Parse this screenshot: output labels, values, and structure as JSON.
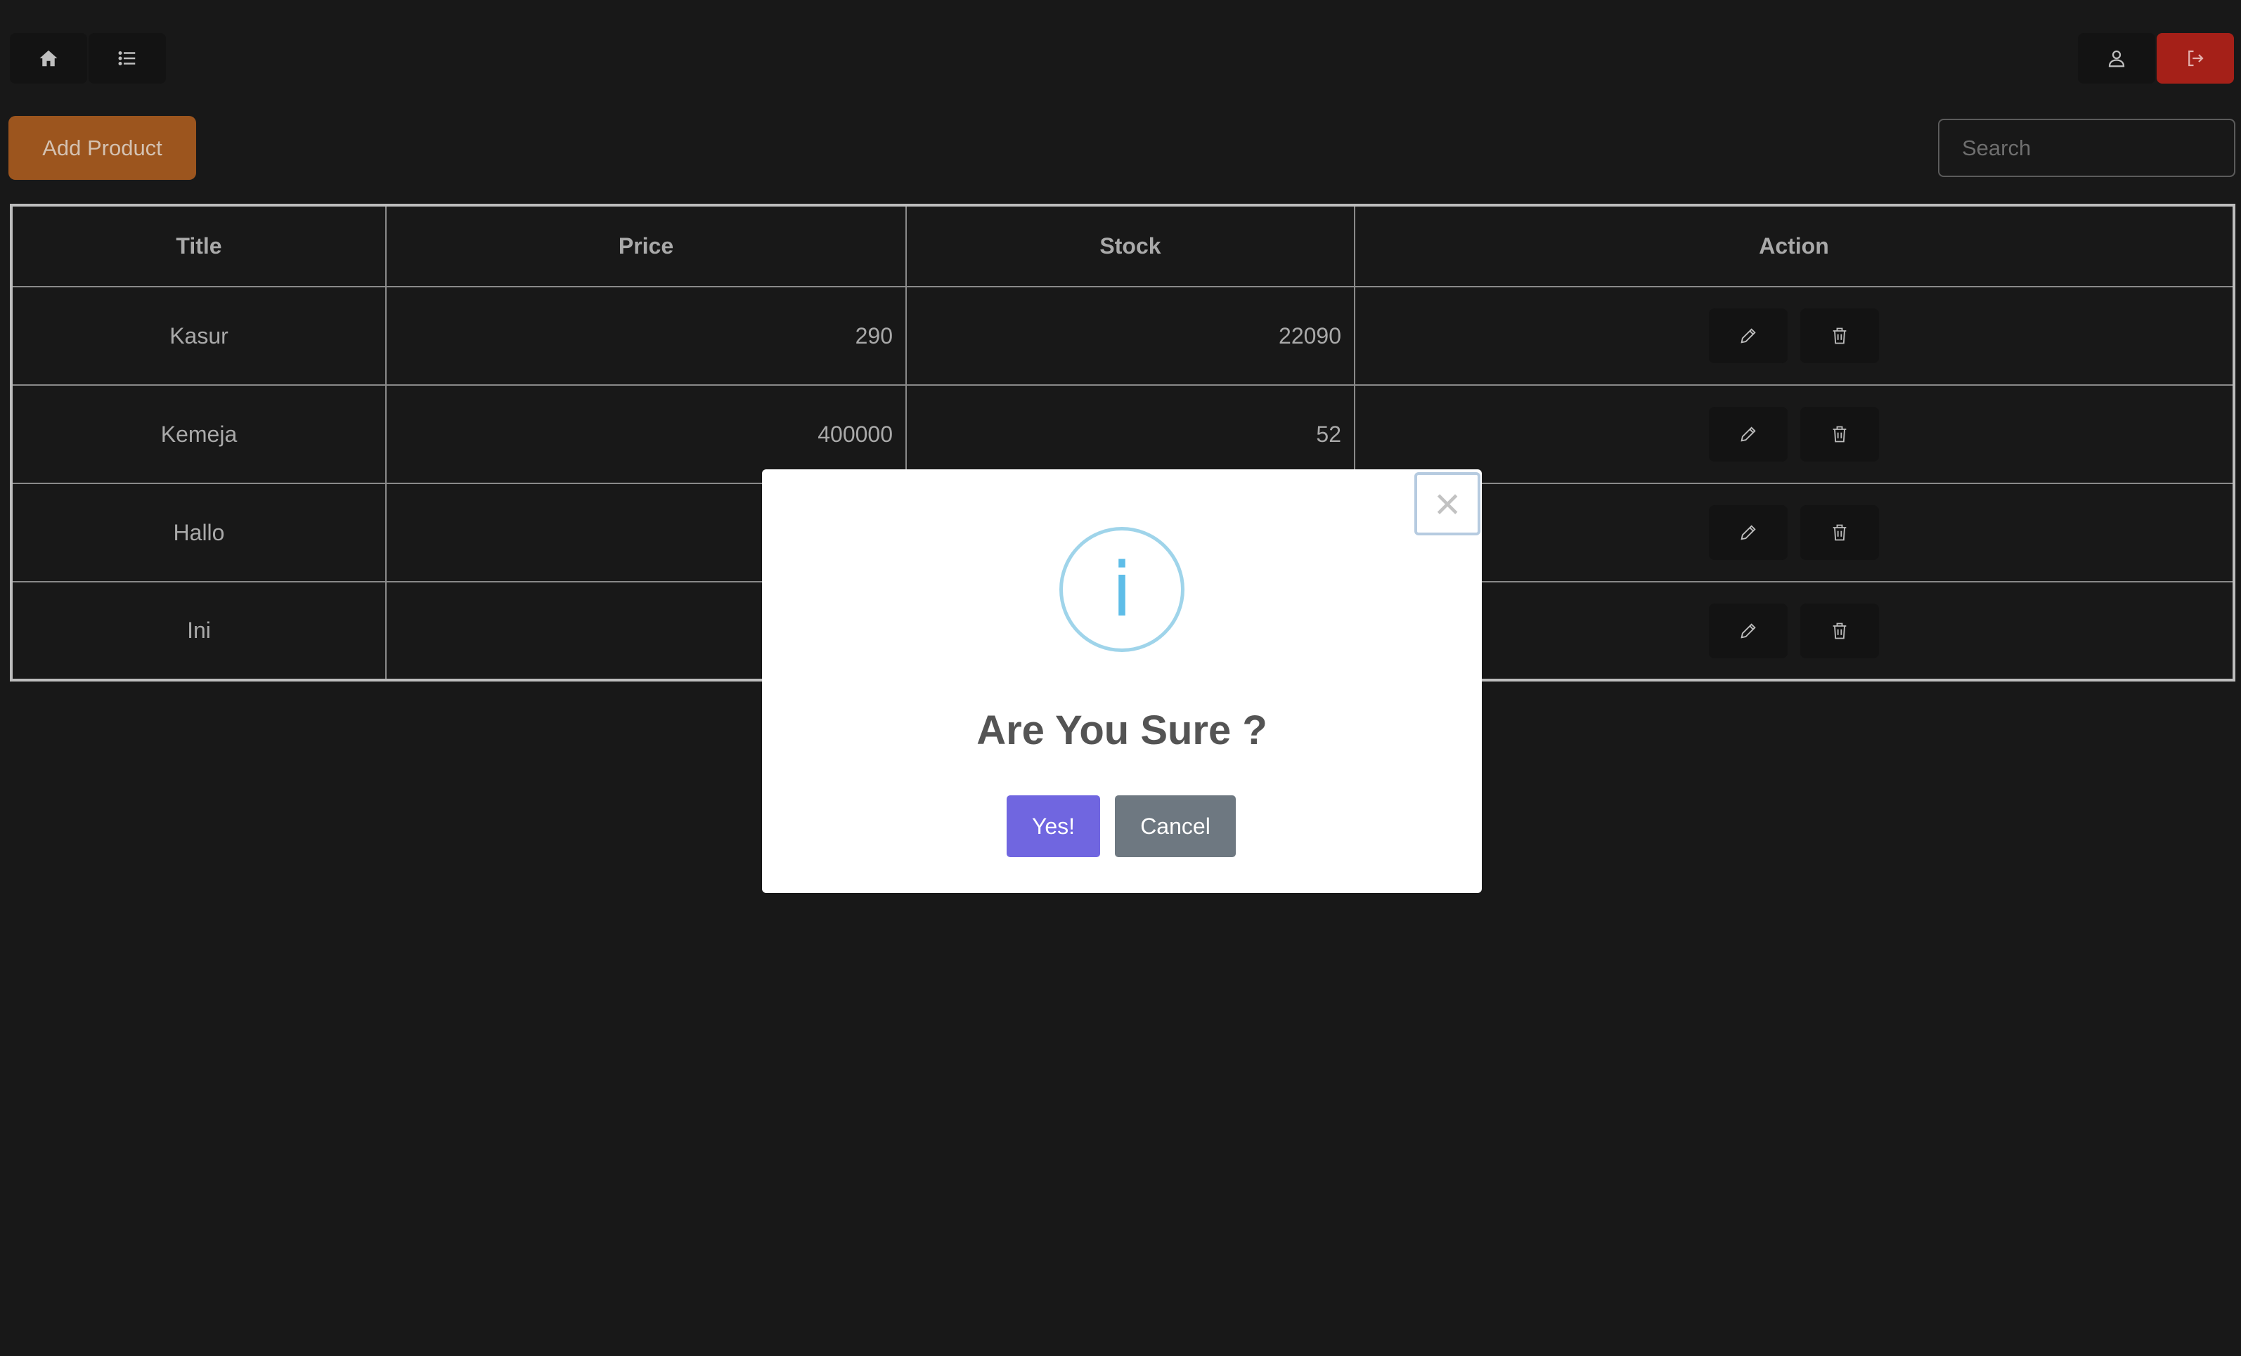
{
  "header": {
    "home_icon": "home-icon",
    "list_icon": "list-icon",
    "user_icon": "user-icon",
    "logout_icon": "logout-icon"
  },
  "toolbar": {
    "add_label": "Add Product",
    "search_placeholder": "Search"
  },
  "table": {
    "headers": [
      "Title",
      "Price",
      "Stock",
      "Action"
    ],
    "rows": [
      {
        "title": "Kasur",
        "price": "290",
        "stock": "22090"
      },
      {
        "title": "Kemeja",
        "price": "400000",
        "stock": "52"
      },
      {
        "title": "Hallo",
        "price": "",
        "stock": ""
      },
      {
        "title": "Ini",
        "price": "",
        "stock": ""
      }
    ]
  },
  "modal": {
    "icon": "info-icon",
    "icon_glyph": "i",
    "close_glyph": "×",
    "title": "Are You Sure ?",
    "confirm_label": "Yes!",
    "cancel_label": "Cancel"
  },
  "colors": {
    "background": "#181818",
    "add_button": "#9c551e",
    "logout_button": "#a52018",
    "confirm_button": "#7066e0",
    "cancel_button": "#6e7881",
    "info_icon": "#5ebde8"
  }
}
